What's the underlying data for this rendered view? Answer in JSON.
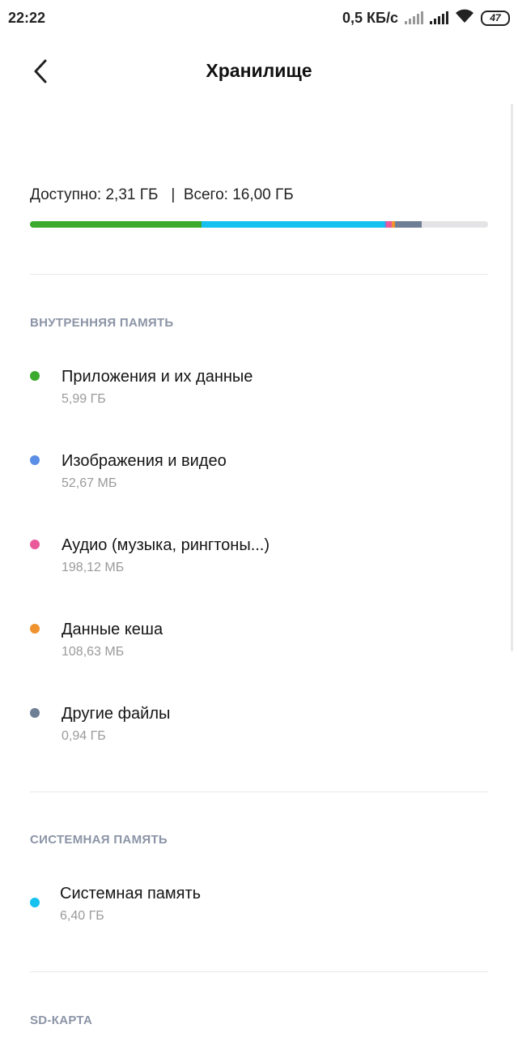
{
  "status_bar": {
    "time": "22:22",
    "speed": "0,5 КБ/с",
    "battery": "47"
  },
  "header": {
    "title": "Хранилище"
  },
  "storage": {
    "available": "Доступно: 2,31 ГБ",
    "separator": "|",
    "total": "Всего: 16,00 ГБ",
    "summary": "Доступно: 2,31 ГБ   |  Всего: 16,00 ГБ",
    "bar_segments": [
      {
        "name": "apps",
        "color": "#3caa2c",
        "fraction": 0.374
      },
      {
        "name": "system",
        "color": "#14c1ef",
        "fraction": 0.4
      },
      {
        "name": "images",
        "color": "#5b8ee6",
        "fraction": 0.004
      },
      {
        "name": "audio",
        "color": "#ea5a9a",
        "fraction": 0.012
      },
      {
        "name": "cache",
        "color": "#f0922d",
        "fraction": 0.007
      },
      {
        "name": "other",
        "color": "#6e7e94",
        "fraction": 0.059
      }
    ]
  },
  "internal_memory": {
    "section_title": "ВНУТРЕННЯЯ ПАМЯТЬ",
    "items": [
      {
        "label": "Приложения и их данные",
        "size": "5,99 ГБ",
        "color": "#3caa2c"
      },
      {
        "label": "Изображения и видео",
        "size": "52,67 МБ",
        "color": "#5b8ee6"
      },
      {
        "label": "Аудио (музыка, рингтоны...)",
        "size": "198,12 МБ",
        "color": "#ea5a9a"
      },
      {
        "label": "Данные кеша",
        "size": "108,63 МБ",
        "color": "#f0922d"
      },
      {
        "label": "Другие файлы",
        "size": "0,94 ГБ",
        "color": "#6e7e94"
      }
    ]
  },
  "system_memory": {
    "section_title": "СИСТЕМНАЯ ПАМЯТЬ",
    "items": [
      {
        "label": "Системная память",
        "size": "6,40 ГБ",
        "color": "#14c1ef"
      }
    ]
  },
  "sd_card": {
    "section_title": "SD-КАРТА"
  }
}
